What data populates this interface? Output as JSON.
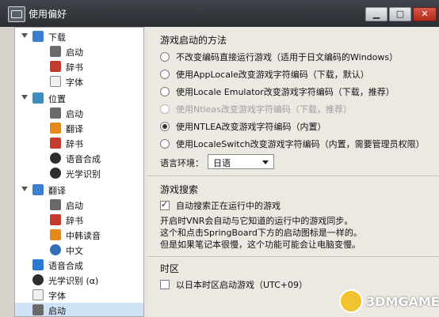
{
  "window": {
    "title": "使用偏好",
    "minimize_label": "▁",
    "maximize_label": "□",
    "close_label": "✕"
  },
  "sidebar": {
    "items": [
      {
        "label": "下载",
        "level": 0,
        "expanded": true,
        "icon": "download-icon"
      },
      {
        "label": "启动",
        "level": 1,
        "icon": "launch-icon"
      },
      {
        "label": "辞书",
        "level": 1,
        "icon": "dictionary-icon"
      },
      {
        "label": "字体",
        "level": 1,
        "icon": "font-icon"
      },
      {
        "label": "位置",
        "level": 0,
        "expanded": true,
        "icon": "location-icon"
      },
      {
        "label": "启动",
        "level": 1,
        "icon": "launch-icon"
      },
      {
        "label": "翻译",
        "level": 1,
        "icon": "translate-icon"
      },
      {
        "label": "辞书",
        "level": 1,
        "icon": "dictionary-icon"
      },
      {
        "label": "语音合成",
        "level": 1,
        "icon": "speech-icon"
      },
      {
        "label": "光学识别",
        "level": 1,
        "icon": "ocr-icon"
      },
      {
        "label": "翻译",
        "level": 0,
        "expanded": true,
        "icon": "users-icon"
      },
      {
        "label": "启动",
        "level": 1,
        "icon": "launch-icon"
      },
      {
        "label": "辞书",
        "level": 1,
        "icon": "dictionary-icon"
      },
      {
        "label": "中韩读音",
        "level": 1,
        "icon": "korean-reading-icon"
      },
      {
        "label": "中文",
        "level": 1,
        "icon": "chinese-globe-icon"
      },
      {
        "label": "语音合成",
        "level": 0,
        "icon": "music-note-icon"
      },
      {
        "label": "光学识别 (α)",
        "level": 0,
        "icon": "ocr-icon"
      },
      {
        "label": "字体",
        "level": 0,
        "icon": "font-icon"
      },
      {
        "label": "启动",
        "level": 0,
        "selected": true,
        "icon": "launch-icon"
      }
    ]
  },
  "launch_method": {
    "title": "游戏启动的方法",
    "options": [
      {
        "label": "不改变编码直接运行游戏（适用于日文编码的Windows）",
        "selected": false,
        "disabled": false
      },
      {
        "label": "使用AppLocale改变游戏字符编码（下载，默认）",
        "selected": false,
        "disabled": false
      },
      {
        "label": "使用Locale Emulator改变游戏字符编码（下载，推荐）",
        "selected": false,
        "disabled": false
      },
      {
        "label": "使用Ntleas改变游戏字符编码（下载，推荐）",
        "selected": false,
        "disabled": true
      },
      {
        "label": "使用NTLEA改变游戏字符编码（内置）",
        "selected": true,
        "disabled": false
      },
      {
        "label": "使用LocaleSwitch改变游戏字符编码（内置，需要管理员权限）",
        "selected": false,
        "disabled": false
      }
    ],
    "language_label": "语言环境：",
    "language_value": "日语"
  },
  "game_search": {
    "title": "游戏搜索",
    "checkbox_label": "自动搜索正在运行中的游戏",
    "checked": true,
    "desc_lines": [
      "开启时VNR会自动与它知道的运行中的游戏同步。",
      "这个和点击SpringBoard下方的启动图标是一样的。",
      "但是如果笔记本很慢，这个功能可能会让电脑变慢。"
    ]
  },
  "timezone": {
    "title": "时区",
    "checkbox_label": "以日本时区启动游戏（UTC+09）",
    "checked": false
  },
  "watermark": {
    "text": "3DMGAME"
  }
}
